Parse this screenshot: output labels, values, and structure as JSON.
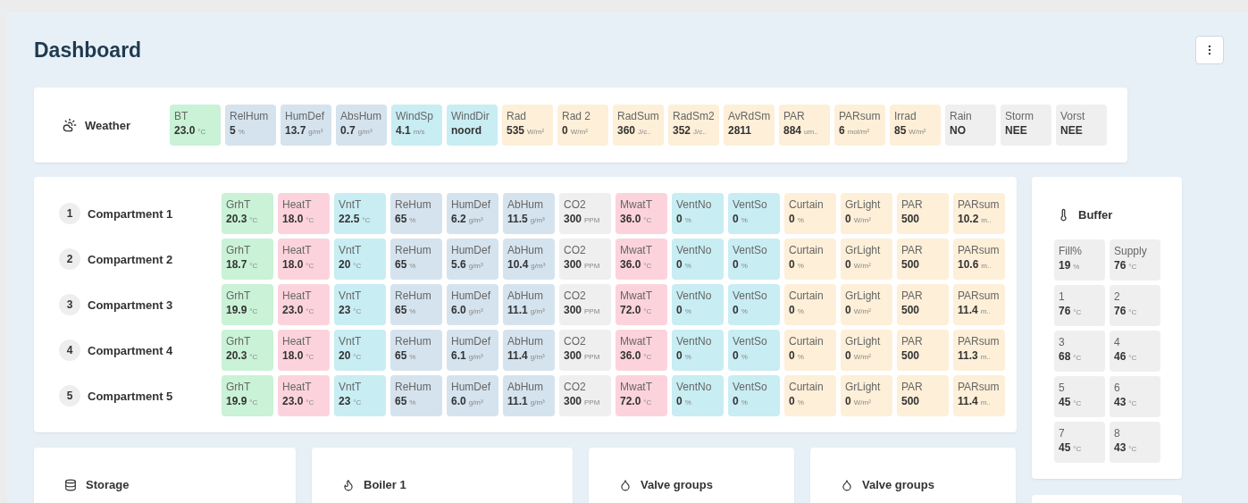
{
  "title": "Dashboard",
  "weather": {
    "title": "Weather",
    "tiles": [
      {
        "label": "BT",
        "value": "23.0",
        "unit": "°C",
        "color": "#c9f2d6"
      },
      {
        "label": "RelHum",
        "value": "5",
        "unit": "%",
        "color": "#d5e3ee"
      },
      {
        "label": "HumDef",
        "value": "13.7",
        "unit": "g/m³",
        "color": "#d5e3ee"
      },
      {
        "label": "AbsHum",
        "value": "0.7",
        "unit": "g/m³",
        "color": "#d5e3ee"
      },
      {
        "label": "WindSp",
        "value": "4.1",
        "unit": "m/s",
        "color": "#c8edf3"
      },
      {
        "label": "WindDir",
        "value": "noord",
        "color": "#c8edf3"
      },
      {
        "label": "Rad",
        "value": "535",
        "unit": "W/m²",
        "color": "#fdefd8"
      },
      {
        "label": "Rad 2",
        "value": "0",
        "unit": "W/m²",
        "color": "#fdefd8"
      },
      {
        "label": "RadSum",
        "value": "360",
        "unit": "J/c..",
        "color": "#fdefd8"
      },
      {
        "label": "RadSm2",
        "value": "352",
        "unit": "J/c..",
        "color": "#fdefd8"
      },
      {
        "label": "AvRdSm",
        "value": "2811",
        "color": "#fdefd8"
      },
      {
        "label": "PAR",
        "value": "884",
        "unit": "um..",
        "color": "#fdefd8"
      },
      {
        "label": "PARsum",
        "value": "6",
        "unit": "mol/m²",
        "color": "#fdefd8"
      },
      {
        "label": "Irrad",
        "value": "85",
        "unit": "W/m²",
        "color": "#fdefd8"
      },
      {
        "label": "Rain",
        "value": "NO",
        "color": "#efefef"
      },
      {
        "label": "Storm",
        "value": "NEE",
        "color": "#efefef"
      },
      {
        "label": "Vorst",
        "value": "NEE",
        "color": "#efefef"
      }
    ]
  },
  "compartments": [
    {
      "number": "1",
      "name": "Compartment 1",
      "tiles": [
        {
          "label": "GrhT",
          "value": "20.3",
          "unit": "°C",
          "color": "#c9f2d6"
        },
        {
          "label": "HeatT",
          "value": "18.0",
          "unit": "°C",
          "color": "#fcd3dc"
        },
        {
          "label": "VntT",
          "value": "22.5",
          "unit": "°C",
          "color": "#c8edf3"
        },
        {
          "label": "ReHum",
          "value": "65",
          "unit": "%",
          "color": "#d5e3ee"
        },
        {
          "label": "HumDef",
          "value": "6.2",
          "unit": "g/m³",
          "color": "#d5e3ee"
        },
        {
          "label": "AbHum",
          "value": "11.5",
          "unit": "g/m³",
          "color": "#d5e3ee"
        },
        {
          "label": "CO2",
          "value": "300",
          "unit": "PPM",
          "color": "#efefef"
        },
        {
          "label": "MwatT",
          "value": "36.0",
          "unit": "°C",
          "color": "#fcd3dc"
        },
        {
          "label": "VentNo",
          "value": "0",
          "unit": "%",
          "color": "#c8edf3"
        },
        {
          "label": "VentSo",
          "value": "0",
          "unit": "%",
          "color": "#c8edf3"
        },
        {
          "label": "Curtain",
          "value": "0",
          "unit": "%",
          "color": "#fdefd8"
        },
        {
          "label": "GrLight",
          "value": "0",
          "unit": "W/m²",
          "color": "#fdefd8"
        },
        {
          "label": "PAR",
          "value": "500",
          "color": "#fdefd8"
        },
        {
          "label": "PARsum",
          "value": "10.2",
          "unit": "m..",
          "color": "#fdefd8"
        }
      ]
    },
    {
      "number": "2",
      "name": "Compartment 2",
      "tiles": [
        {
          "label": "GrhT",
          "value": "18.7",
          "unit": "°C",
          "color": "#c9f2d6"
        },
        {
          "label": "HeatT",
          "value": "18.0",
          "unit": "°C",
          "color": "#fcd3dc"
        },
        {
          "label": "VntT",
          "value": "20",
          "unit": "°C",
          "color": "#c8edf3"
        },
        {
          "label": "ReHum",
          "value": "65",
          "unit": "%",
          "color": "#d5e3ee"
        },
        {
          "label": "HumDef",
          "value": "5.6",
          "unit": "g/m³",
          "color": "#d5e3ee"
        },
        {
          "label": "AbHum",
          "value": "10.4",
          "unit": "g/m³",
          "color": "#d5e3ee"
        },
        {
          "label": "CO2",
          "value": "300",
          "unit": "PPM",
          "color": "#efefef"
        },
        {
          "label": "MwatT",
          "value": "36.0",
          "unit": "°C",
          "color": "#fcd3dc"
        },
        {
          "label": "VentNo",
          "value": "0",
          "unit": "%",
          "color": "#c8edf3"
        },
        {
          "label": "VentSo",
          "value": "0",
          "unit": "%",
          "color": "#c8edf3"
        },
        {
          "label": "Curtain",
          "value": "0",
          "unit": "%",
          "color": "#fdefd8"
        },
        {
          "label": "GrLight",
          "value": "0",
          "unit": "W/m²",
          "color": "#fdefd8"
        },
        {
          "label": "PAR",
          "value": "500",
          "color": "#fdefd8"
        },
        {
          "label": "PARsum",
          "value": "10.6",
          "unit": "m..",
          "color": "#fdefd8"
        }
      ]
    },
    {
      "number": "3",
      "name": "Compartment 3",
      "tiles": [
        {
          "label": "GrhT",
          "value": "19.9",
          "unit": "°C",
          "color": "#c9f2d6"
        },
        {
          "label": "HeatT",
          "value": "23.0",
          "unit": "°C",
          "color": "#fcd3dc"
        },
        {
          "label": "VntT",
          "value": "23",
          "unit": "°C",
          "color": "#c8edf3"
        },
        {
          "label": "ReHum",
          "value": "65",
          "unit": "%",
          "color": "#d5e3ee"
        },
        {
          "label": "HumDef",
          "value": "6.0",
          "unit": "g/m³",
          "color": "#d5e3ee"
        },
        {
          "label": "AbHum",
          "value": "11.1",
          "unit": "g/m³",
          "color": "#d5e3ee"
        },
        {
          "label": "CO2",
          "value": "300",
          "unit": "PPM",
          "color": "#efefef"
        },
        {
          "label": "MwatT",
          "value": "72.0",
          "unit": "°C",
          "color": "#fcd3dc"
        },
        {
          "label": "VentNo",
          "value": "0",
          "unit": "%",
          "color": "#c8edf3"
        },
        {
          "label": "VentSo",
          "value": "0",
          "unit": "%",
          "color": "#c8edf3"
        },
        {
          "label": "Curtain",
          "value": "0",
          "unit": "%",
          "color": "#fdefd8"
        },
        {
          "label": "GrLight",
          "value": "0",
          "unit": "W/m²",
          "color": "#fdefd8"
        },
        {
          "label": "PAR",
          "value": "500",
          "color": "#fdefd8"
        },
        {
          "label": "PARsum",
          "value": "11.4",
          "unit": "m..",
          "color": "#fdefd8"
        }
      ]
    },
    {
      "number": "4",
      "name": "Compartment 4",
      "tiles": [
        {
          "label": "GrhT",
          "value": "20.3",
          "unit": "°C",
          "color": "#c9f2d6"
        },
        {
          "label": "HeatT",
          "value": "18.0",
          "unit": "°C",
          "color": "#fcd3dc"
        },
        {
          "label": "VntT",
          "value": "20",
          "unit": "°C",
          "color": "#c8edf3"
        },
        {
          "label": "ReHum",
          "value": "65",
          "unit": "%",
          "color": "#d5e3ee"
        },
        {
          "label": "HumDef",
          "value": "6.1",
          "unit": "g/m³",
          "color": "#d5e3ee"
        },
        {
          "label": "AbHum",
          "value": "11.4",
          "unit": "g/m³",
          "color": "#d5e3ee"
        },
        {
          "label": "CO2",
          "value": "300",
          "unit": "PPM",
          "color": "#efefef"
        },
        {
          "label": "MwatT",
          "value": "36.0",
          "unit": "°C",
          "color": "#fcd3dc"
        },
        {
          "label": "VentNo",
          "value": "0",
          "unit": "%",
          "color": "#c8edf3"
        },
        {
          "label": "VentSo",
          "value": "0",
          "unit": "%",
          "color": "#c8edf3"
        },
        {
          "label": "Curtain",
          "value": "0",
          "unit": "%",
          "color": "#fdefd8"
        },
        {
          "label": "GrLight",
          "value": "0",
          "unit": "W/m²",
          "color": "#fdefd8"
        },
        {
          "label": "PAR",
          "value": "500",
          "color": "#fdefd8"
        },
        {
          "label": "PARsum",
          "value": "11.3",
          "unit": "m..",
          "color": "#fdefd8"
        }
      ]
    },
    {
      "number": "5",
      "name": "Compartment 5",
      "tiles": [
        {
          "label": "GrhT",
          "value": "19.9",
          "unit": "°C",
          "color": "#c9f2d6"
        },
        {
          "label": "HeatT",
          "value": "23.0",
          "unit": "°C",
          "color": "#fcd3dc"
        },
        {
          "label": "VntT",
          "value": "23",
          "unit": "°C",
          "color": "#c8edf3"
        },
        {
          "label": "ReHum",
          "value": "65",
          "unit": "%",
          "color": "#d5e3ee"
        },
        {
          "label": "HumDef",
          "value": "6.0",
          "unit": "g/m³",
          "color": "#d5e3ee"
        },
        {
          "label": "AbHum",
          "value": "11.1",
          "unit": "g/m³",
          "color": "#d5e3ee"
        },
        {
          "label": "CO2",
          "value": "300",
          "unit": "PPM",
          "color": "#efefef"
        },
        {
          "label": "MwatT",
          "value": "72.0",
          "unit": "°C",
          "color": "#fcd3dc"
        },
        {
          "label": "VentNo",
          "value": "0",
          "unit": "%",
          "color": "#c8edf3"
        },
        {
          "label": "VentSo",
          "value": "0",
          "unit": "%",
          "color": "#c8edf3"
        },
        {
          "label": "Curtain",
          "value": "0",
          "unit": "%",
          "color": "#fdefd8"
        },
        {
          "label": "GrLight",
          "value": "0",
          "unit": "W/m²",
          "color": "#fdefd8"
        },
        {
          "label": "PAR",
          "value": "500",
          "color": "#fdefd8"
        },
        {
          "label": "PARsum",
          "value": "11.4",
          "unit": "m..",
          "color": "#fdefd8"
        }
      ]
    }
  ],
  "buffer": {
    "title": "Buffer",
    "tiles": [
      {
        "label": "Fill%",
        "value": "19",
        "unit": "%"
      },
      {
        "label": "Supply",
        "value": "76",
        "unit": "°C"
      },
      {
        "label": "1",
        "value": "76",
        "unit": "°C"
      },
      {
        "label": "2",
        "value": "76",
        "unit": "°C"
      },
      {
        "label": "3",
        "value": "68",
        "unit": "°C"
      },
      {
        "label": "4",
        "value": "46",
        "unit": "°C"
      },
      {
        "label": "5",
        "value": "45",
        "unit": "°C"
      },
      {
        "label": "6",
        "value": "43",
        "unit": "°C"
      },
      {
        "label": "7",
        "value": "45",
        "unit": "°C"
      },
      {
        "label": "8",
        "value": "43",
        "unit": "°C"
      }
    ]
  },
  "panels": [
    {
      "kind": "storage",
      "title": "Storage"
    },
    {
      "kind": "boiler",
      "title": "Boiler 1"
    },
    {
      "kind": "valve",
      "title": "Valve groups"
    },
    {
      "kind": "valve",
      "title": "Valve groups"
    }
  ]
}
